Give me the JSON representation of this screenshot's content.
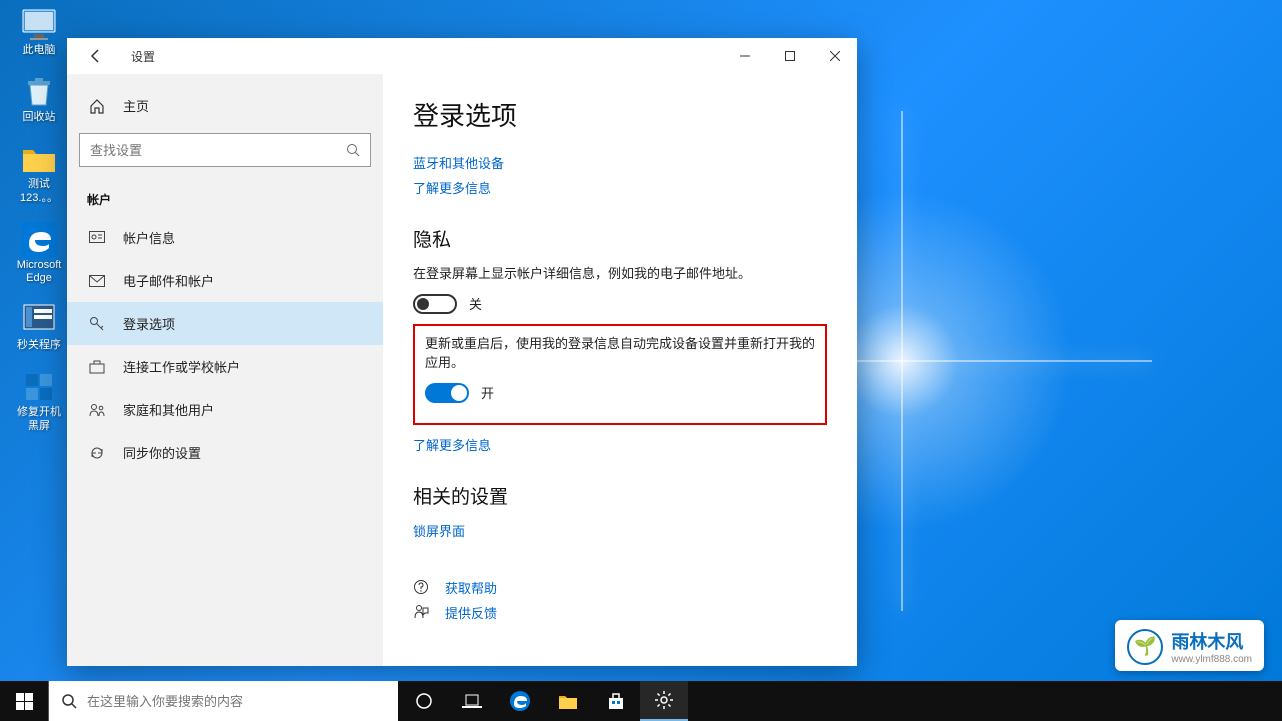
{
  "settings_window": {
    "title": "设置",
    "home_label": "主页",
    "search_placeholder": "查找设置",
    "category_label": "帐户",
    "nav": [
      {
        "label": "帐户信息"
      },
      {
        "label": "电子邮件和帐户"
      },
      {
        "label": "登录选项"
      },
      {
        "label": "连接工作或学校帐户"
      },
      {
        "label": "家庭和其他用户"
      },
      {
        "label": "同步你的设置"
      }
    ],
    "content": {
      "page_title": "登录选项",
      "link_bluetooth": "蓝牙和其他设备",
      "link_learn_more_1": "了解更多信息",
      "privacy_heading": "隐私",
      "privacy_desc": "在登录屏幕上显示帐户详细信息，例如我的电子邮件地址。",
      "toggle_off_label": "关",
      "restart_desc": "更新或重启后，使用我的登录信息自动完成设备设置并重新打开我的应用。",
      "toggle_on_label": "开",
      "link_learn_more_2": "了解更多信息",
      "related_heading": "相关的设置",
      "link_lockscreen": "锁屏界面",
      "link_help": "获取帮助",
      "link_feedback": "提供反馈"
    }
  },
  "desktop": {
    "icons": [
      {
        "label": "此电脑"
      },
      {
        "label": "回收站"
      },
      {
        "label": "测试123.。。"
      },
      {
        "label": "Microsoft Edge"
      },
      {
        "label": "秒关程序"
      },
      {
        "label": "修复开机黑屏"
      }
    ]
  },
  "taskbar": {
    "search_placeholder": "在这里输入你要搜索的内容"
  },
  "watermark": {
    "brand": "雨林木风",
    "url": "www.ylmf888.com"
  }
}
